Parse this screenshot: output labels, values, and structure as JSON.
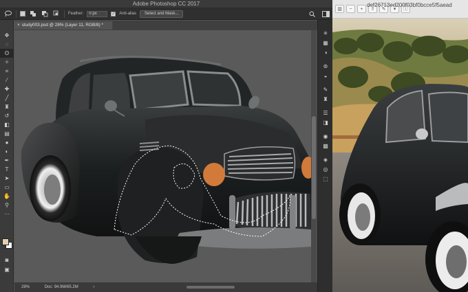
{
  "app": {
    "title": "Adobe Photoshop CC 2017"
  },
  "options_bar": {
    "feather_label": "Feather:",
    "feather_value": "0 px",
    "anti_alias_label": "Anti-alias",
    "select_mask_label": "Select and Mask..."
  },
  "document": {
    "tab_title": "study003.psd @ 28% (Layer 11, RGB/8) *",
    "zoom": "28%",
    "doc_info": "Doc: 94.9M/65.2M",
    "status_arrow": "›"
  },
  "colors": {
    "foreground": "#e3d0b1",
    "background": "#ffffff",
    "canvas": "#5a5a5a",
    "headlight": "#d27a3a"
  },
  "browser": {
    "url": "def26713ed200f03bf0bcce5f5aead",
    "nav_icons": [
      "sidebar-icon",
      "zoom-out-icon",
      "zoom-in-icon",
      "share-icon",
      "markup-icon",
      "edit-icon",
      "info-icon"
    ]
  }
}
